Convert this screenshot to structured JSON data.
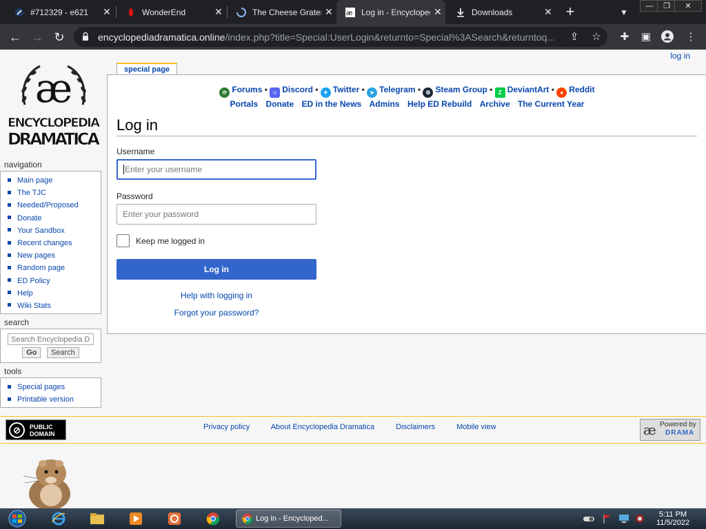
{
  "browser": {
    "tabs": [
      {
        "title": "#712329 - e621",
        "active": false,
        "icon": "e621-favicon"
      },
      {
        "title": "WonderEnd",
        "active": false,
        "icon": "red-drop-favicon"
      },
      {
        "title": "The Cheese Grater",
        "active": false,
        "icon": "loading-spinner-icon"
      },
      {
        "title": "Log in - Encyclopedia Dramatica",
        "active": true,
        "icon": "ed-favicon"
      },
      {
        "title": "Downloads",
        "active": false,
        "icon": "download-icon"
      }
    ],
    "url_host": "encyclopediadramatica.online",
    "url_path": "/index.php?title=Special:UserLogin&returnto=Special%3ASearch&returntoq..."
  },
  "page": {
    "personal_login": "log in",
    "logo_text_top": "ENCYCLOPEDIA",
    "logo_text_bottom": "DRAMATICA",
    "tab_label": "special page",
    "navigation": {
      "title": "navigation",
      "items": [
        "Main page",
        "The TJC",
        "Needed/Proposed",
        "Donate",
        "Your Sandbox",
        "Recent changes",
        "New pages",
        "Random page",
        "ED Policy",
        "Help",
        "Wiki Stats"
      ]
    },
    "search": {
      "title": "search",
      "placeholder": "Search Encyclopedia Dramatica",
      "go": "Go",
      "search": "Search"
    },
    "tools": {
      "title": "tools",
      "items": [
        "Special pages",
        "Printable version"
      ]
    },
    "social_links": [
      {
        "label": "Forums",
        "color": "#2e7d32"
      },
      {
        "label": "Discord",
        "color": "#5865f2"
      },
      {
        "label": "Twitter",
        "color": "#1da1f2"
      },
      {
        "label": "Telegram",
        "color": "#2aa3e0"
      },
      {
        "label": "Steam Group",
        "color": "#1b2838"
      },
      {
        "label": "DeviantArt",
        "color": "#05cc47"
      },
      {
        "label": "Reddit",
        "color": "#ff4500"
      }
    ],
    "quick_links": [
      "Portals",
      "Donate",
      "ED in the News",
      "Admins",
      "Help ED Rebuild",
      "Archive",
      "The Current Year"
    ],
    "heading": "Log in",
    "form": {
      "username_label": "Username",
      "username_placeholder": "Enter your username",
      "password_label": "Password",
      "password_placeholder": "Enter your password",
      "remember_label": "Keep me logged in",
      "login_button": "Log in",
      "help_link": "Help with logging in",
      "forgot_link": "Forgot your password?"
    },
    "footer": {
      "links": [
        "Privacy policy",
        "About Encyclopedia Dramatica",
        "Disclaimers",
        "Mobile view"
      ],
      "pd_line1": "PUBLIC",
      "pd_line2": "DOMAIN",
      "powered_line1": "Powered by",
      "powered_line2": "DRAMA"
    }
  },
  "taskbar": {
    "window_title": "Log in - Encycloped...",
    "time": "5:11 PM",
    "date": "11/5/2022"
  },
  "colors": {
    "link": "#0645ad",
    "button": "#3366cc",
    "chrome_dark": "#202124"
  }
}
